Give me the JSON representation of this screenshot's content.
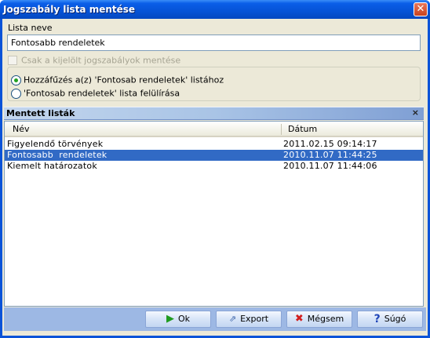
{
  "window": {
    "title": "Jogszabály lista mentése",
    "close_glyph": "✕"
  },
  "form": {
    "name_label": "Lista neve",
    "name_value": "Fontosabb rendeletek",
    "only_selected_label": "Csak a kijelölt jogszabályok mentése",
    "only_selected_checked": false,
    "only_selected_enabled": false,
    "radio_options": [
      {
        "label": "Hozzáfűzés a(z) 'Fontosab rendeletek' listához",
        "checked": true
      },
      {
        "label": "'Fontosab rendeletek' lista felülírása",
        "checked": false
      }
    ]
  },
  "saved_lists": {
    "title": "Mentett listák",
    "close_glyph": "×",
    "columns": {
      "name": "Név",
      "date": "Dátum"
    },
    "rows": [
      {
        "name": "Figyelendő törvények",
        "date": "2011.02.15 09:14:17",
        "selected": false
      },
      {
        "name": "Fontosabb  rendeletek",
        "date": "2010.11.07 11:44:25",
        "selected": true
      },
      {
        "name": "Kiemelt határozatok",
        "date": "2010.11.07 11:44:06",
        "selected": false
      }
    ]
  },
  "buttons": {
    "ok": {
      "label": "Ok",
      "icon": "play-arrow-icon"
    },
    "export": {
      "label": "Export",
      "icon": "export-icon"
    },
    "cancel": {
      "label": "Mégsem",
      "icon": "red-x-icon"
    },
    "help": {
      "label": "Súgó",
      "icon": "question-icon"
    }
  },
  "colors": {
    "title_bar": "#0653d6",
    "selection": "#316ac5",
    "button_bar": "#9db8e4"
  }
}
